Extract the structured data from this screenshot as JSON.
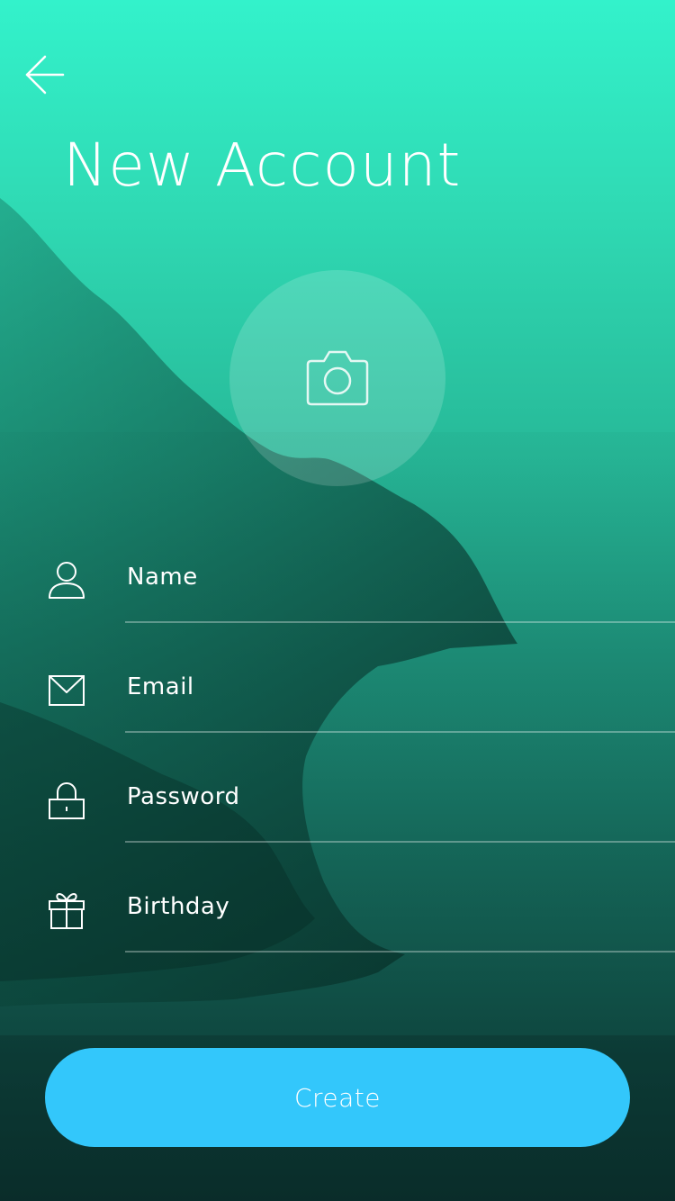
{
  "header": {
    "back_icon": "arrow-left-icon",
    "title": "New Account"
  },
  "avatar_picker": {
    "icon": "camera-icon"
  },
  "form": {
    "fields": [
      {
        "id": "name",
        "icon": "person-icon",
        "placeholder": "Name",
        "type": "text"
      },
      {
        "id": "email",
        "icon": "envelope-icon",
        "placeholder": "Email",
        "type": "email"
      },
      {
        "id": "password",
        "icon": "lock-icon",
        "placeholder": "Password",
        "type": "password"
      },
      {
        "id": "birthday",
        "icon": "gift-icon",
        "placeholder": "Birthday",
        "type": "text"
      }
    ]
  },
  "actions": {
    "create_label": "Create"
  },
  "colors": {
    "gradient_top": "#33f2cb",
    "gradient_bottom": "#0b3a35",
    "button": "#33c7fb",
    "text": "#ffffff"
  }
}
